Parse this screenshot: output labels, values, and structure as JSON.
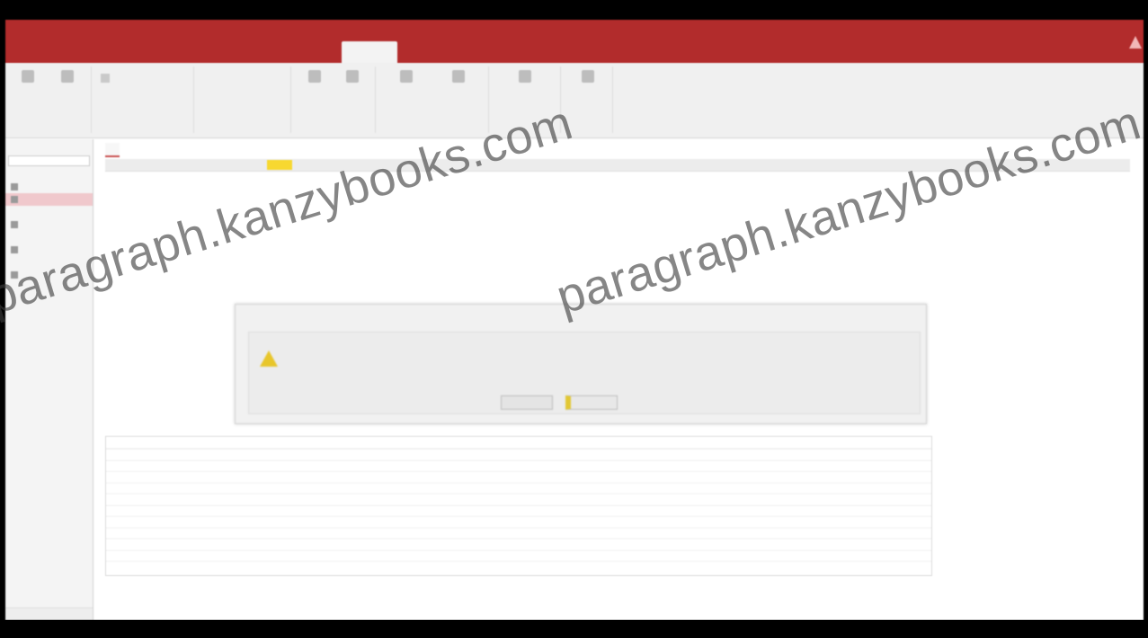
{
  "watermark": {
    "text": "paragraph.kanzybooks.com"
  },
  "colors": {
    "ribbon_accent": "#b22c2c",
    "selected_nav": "#f0c8cc",
    "highlight_field": "#f7d830",
    "warning": "#e8c62a"
  },
  "icons": {
    "warning": "warning-triangle-icon"
  }
}
